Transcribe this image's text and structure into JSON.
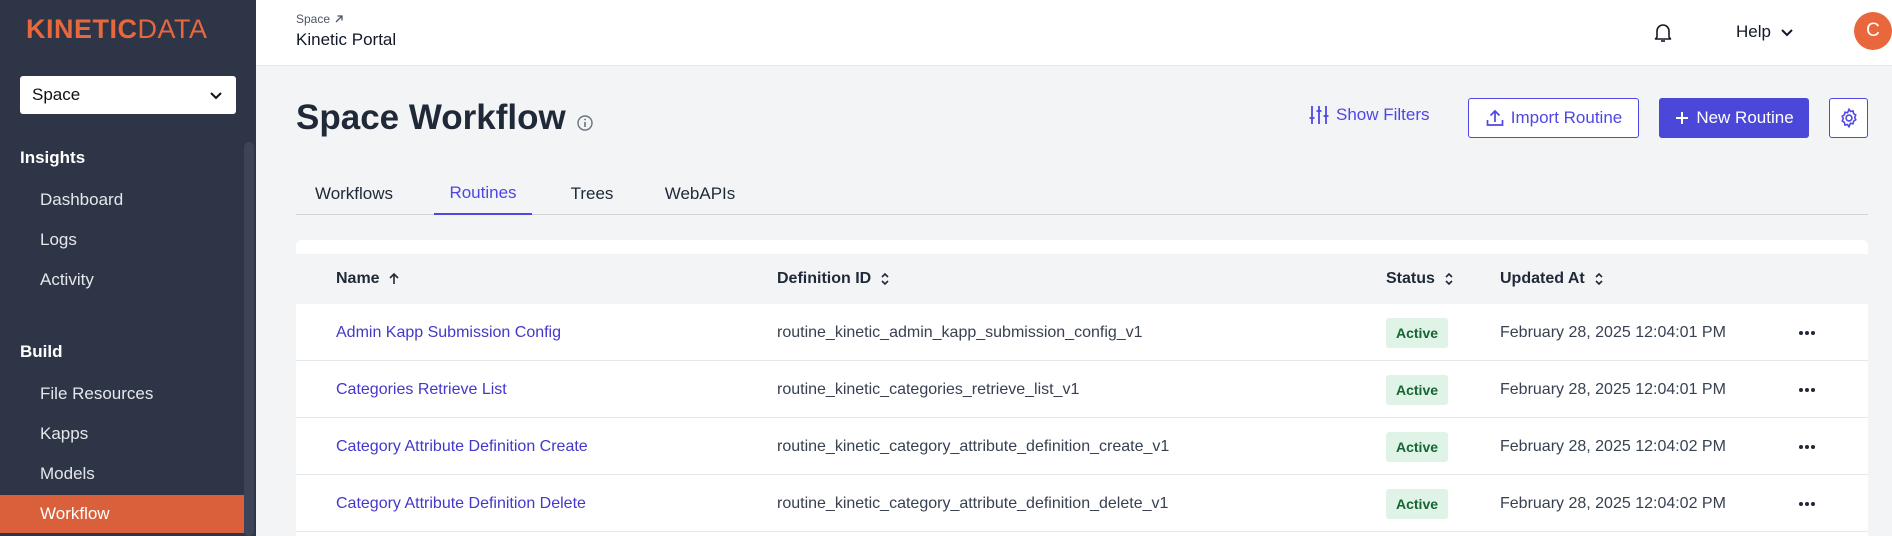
{
  "app": {
    "logo_bold": "KINETIC",
    "logo_thin": "DATA"
  },
  "sidebar": {
    "space_select": "Space",
    "sections": [
      {
        "title": "Insights",
        "items": [
          "Dashboard",
          "Logs",
          "Activity"
        ]
      },
      {
        "title": "Build",
        "items": [
          "File Resources",
          "Kapps",
          "Models",
          "Workflow"
        ]
      }
    ],
    "active_item": "Workflow"
  },
  "header": {
    "breadcrumb_parent": "Space",
    "breadcrumb_current": "Kinetic Portal",
    "help_label": "Help",
    "avatar_initial": "C"
  },
  "page": {
    "title": "Space Workflow",
    "show_filters_label": "Show Filters",
    "import_label": "Import Routine",
    "new_label": "New Routine"
  },
  "tabs": [
    "Workflows",
    "Routines",
    "Trees",
    "WebAPIs"
  ],
  "active_tab": "Routines",
  "table": {
    "columns": [
      "Name",
      "Definition ID",
      "Status",
      "Updated At"
    ],
    "rows": [
      {
        "name": "Admin Kapp Submission Config",
        "definition_id": "routine_kinetic_admin_kapp_submission_config_v1",
        "status": "Active",
        "updated_at": "February 28, 2025 12:04:01 PM"
      },
      {
        "name": "Categories Retrieve List",
        "definition_id": "routine_kinetic_categories_retrieve_list_v1",
        "status": "Active",
        "updated_at": "February 28, 2025 12:04:01 PM"
      },
      {
        "name": "Category Attribute Definition Create",
        "definition_id": "routine_kinetic_category_attribute_definition_create_v1",
        "status": "Active",
        "updated_at": "February 28, 2025 12:04:02 PM"
      },
      {
        "name": "Category Attribute Definition Delete",
        "definition_id": "routine_kinetic_category_attribute_definition_delete_v1",
        "status": "Active",
        "updated_at": "February 28, 2025 12:04:02 PM"
      }
    ]
  },
  "colors": {
    "brand": "#e8673d",
    "accent": "#4f46e5",
    "sidebar_bg": "#2e3547",
    "active_nav": "#d9603a",
    "badge_bg": "#dff3e6"
  }
}
